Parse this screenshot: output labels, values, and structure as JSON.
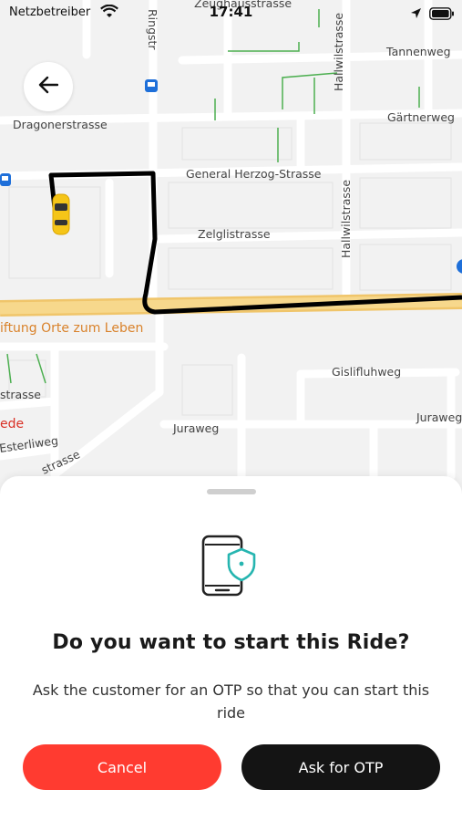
{
  "status_bar": {
    "carrier": "Netzbetreiber",
    "time": "17:41",
    "icons": [
      "wifi-icon",
      "location-arrow-icon",
      "battery-icon"
    ]
  },
  "map": {
    "street_labels": {
      "zeughausstrasse": "Zeughausstrasse",
      "ringstrasse": "Ringstr",
      "hallwilstrasse_top": "Hallwilstrasse",
      "tannenweg": "Tannenweg",
      "dragonerstrasse": "Dragonerstrasse",
      "gaertnerweg": "Gärtnerweg",
      "general_herzog": "General Herzog-Strasse",
      "hallwilstrasse": "Hallwilstrasse",
      "zelglistrasse": "Zelglistrasse",
      "stiftung": "iftung Orte zum Leben",
      "gislifluhweg": "Gislifluhweg",
      "strasse_left": "strasse",
      "juraweg_right": "Juraweg",
      "ede": "ede",
      "juraweg": "Juraweg",
      "esterliweg": "Esterliweg",
      "strasse_diag": "strasse"
    },
    "colors": {
      "main_road": "#f6d27a",
      "route": "#000000",
      "taxi": "#f5c518",
      "path_green": "#4caf50"
    }
  },
  "back_button": {
    "icon": "arrow-left-icon"
  },
  "sheet": {
    "icon": "phone-shield-icon",
    "title": "Do you want to start this Ride?",
    "subtitle": "Ask the customer for an OTP so that you can start this ride",
    "cancel_label": "Cancel",
    "otp_label": "Ask for OTP",
    "colors": {
      "cancel": "#ff3b30",
      "otp": "#141414",
      "shield_accent": "#26b5b0"
    }
  }
}
